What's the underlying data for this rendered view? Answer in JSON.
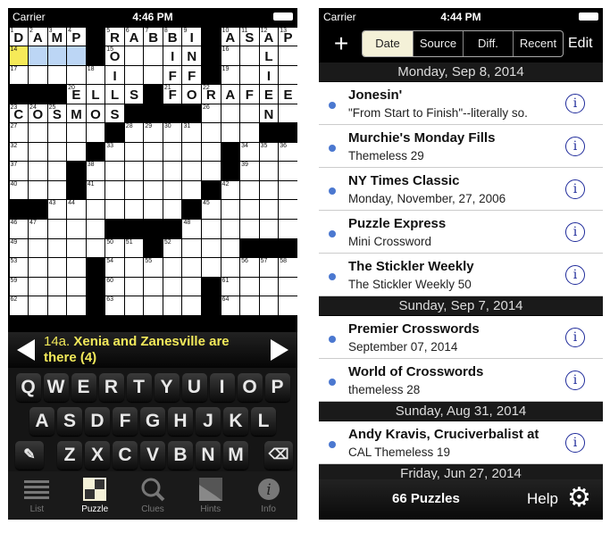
{
  "left": {
    "status": {
      "carrier": "Carrier",
      "time": "4:46 PM"
    },
    "grid": {
      "rows": [
        "DAMP#RABBI#ASAP",
        "....#O..IN#..L.",
        ".....I..FF#..I.",
        "###ELLS#FORAFEE",
        "COSMOS####...N.",
        ".....#.......##",
        "....#......#...",
        "...#.......#...",
        "...#......#....",
        "##.......#.....",
        ".....####......",
        ".......#....###",
        "....#..........",
        "....#.....#....",
        "....#.....#...."
      ],
      "numbers": [
        [
          "1",
          "2",
          "3",
          "4",
          "",
          "5",
          "6",
          "7",
          "8",
          "9",
          "",
          "10",
          "11",
          "12",
          "13"
        ],
        [
          "14",
          "",
          "",
          "",
          "",
          "15",
          "",
          "",
          "",
          "",
          "",
          "16",
          "",
          "",
          ""
        ],
        [
          "17",
          "",
          "",
          "",
          "18",
          "",
          "",
          "",
          "",
          "",
          "",
          "19",
          "",
          "",
          ""
        ],
        [
          "",
          "",
          "",
          "20",
          "",
          "",
          "",
          "",
          "21",
          "",
          "22",
          "",
          "",
          "",
          ""
        ],
        [
          "23",
          "24",
          "25",
          "",
          "",
          "",
          "",
          "",
          "",
          "",
          "26",
          "",
          "",
          "",
          ""
        ],
        [
          "27",
          "",
          "",
          "",
          "",
          "",
          "28",
          "29",
          "30",
          "31",
          "",
          "",
          "",
          "",
          ""
        ],
        [
          "32",
          "",
          "",
          "",
          "",
          "33",
          "",
          "",
          "",
          "",
          "",
          "",
          "34",
          "35",
          "36"
        ],
        [
          "37",
          "",
          "",
          "",
          "38",
          "",
          "",
          "",
          "",
          "",
          "",
          "",
          "39",
          "",
          ""
        ],
        [
          "40",
          "",
          "",
          "",
          "41",
          "",
          "",
          "",
          "",
          "",
          "",
          "42",
          "",
          "",
          ""
        ],
        [
          "",
          "",
          "43",
          "44",
          "",
          "",
          "",
          "",
          "",
          "",
          "45",
          "",
          "",
          "",
          ""
        ],
        [
          "46",
          "47",
          "",
          "",
          "",
          "",
          "",
          "",
          "",
          "48",
          "",
          "",
          "",
          "",
          ""
        ],
        [
          "49",
          "",
          "",
          "",
          "",
          "50",
          "51",
          "",
          "52",
          "",
          "",
          "",
          "",
          "",
          ""
        ],
        [
          "53",
          "",
          "",
          "",
          "",
          "54",
          "",
          "55",
          "",
          "",
          "",
          "",
          "56",
          "57",
          "58"
        ],
        [
          "59",
          "",
          "",
          "",
          "",
          "60",
          "",
          "",
          "",
          "",
          "",
          "61",
          "",
          "",
          ""
        ],
        [
          "62",
          "",
          "",
          "",
          "",
          "63",
          "",
          "",
          "",
          "",
          "",
          "64",
          "",
          "",
          ""
        ]
      ],
      "current_cell": [
        1,
        0
      ],
      "highlighted_cells": [
        [
          1,
          1
        ],
        [
          1,
          2
        ],
        [
          1,
          3
        ]
      ],
      "colors": {
        "current": "#f6ea58",
        "highlight": "#bcd6f5"
      }
    },
    "clue": {
      "number": "14a.",
      "text": "Xenia and Zanesville are there (4)"
    },
    "keyboard": {
      "rows": [
        [
          "Q",
          "W",
          "E",
          "R",
          "T",
          "Y",
          "U",
          "I",
          "O",
          "P"
        ],
        [
          "A",
          "S",
          "D",
          "F",
          "G",
          "H",
          "J",
          "K",
          "L"
        ],
        [
          "Z",
          "X",
          "C",
          "V",
          "B",
          "N",
          "M"
        ]
      ]
    },
    "tabs": [
      {
        "label": "List",
        "icon": "list-icon"
      },
      {
        "label": "Puzzle",
        "icon": "puzzle-grid-icon",
        "active": true
      },
      {
        "label": "Clues",
        "icon": "magnifier-icon"
      },
      {
        "label": "Hints",
        "icon": "hints-icon"
      },
      {
        "label": "Info",
        "icon": "info-icon"
      }
    ]
  },
  "right": {
    "status": {
      "carrier": "Carrier",
      "time": "4:44 PM"
    },
    "nav": {
      "add": "+",
      "segments": [
        "Date",
        "Source",
        "Diff.",
        "Recent"
      ],
      "selected": "Date",
      "edit": "Edit"
    },
    "sections": [
      {
        "header": "Monday, Sep 8, 2014",
        "items": [
          {
            "title": "Jonesin'",
            "subtitle": "\"From Start to Finish\"--literally so."
          },
          {
            "title": "Murchie's Monday Fills",
            "subtitle": "Themeless 29"
          },
          {
            "title": "NY Times Classic",
            "subtitle": "Monday, November, 27, 2006"
          },
          {
            "title": "Puzzle Express",
            "subtitle": "Mini Crossword"
          },
          {
            "title": "The Stickler Weekly",
            "subtitle": "The Stickler Weekly 50"
          }
        ]
      },
      {
        "header": "Sunday, Sep 7, 2014",
        "items": [
          {
            "title": "Premier Crosswords",
            "subtitle": "September 07, 2014"
          },
          {
            "title": "World of Crosswords",
            "subtitle": "themeless 28"
          }
        ]
      },
      {
        "header": "Sunday, Aug 31, 2014",
        "items": [
          {
            "title": "Andy Kravis, Cruciverbalist at",
            "subtitle": "CAL Themeless 19"
          }
        ]
      },
      {
        "header": "Friday, Jun 27, 2014",
        "items": []
      }
    ],
    "bottom": {
      "count": "66 Puzzles",
      "help": "Help"
    },
    "colors": {
      "unread_dot": "#4b78d0",
      "info": "#1e2a9a"
    }
  }
}
